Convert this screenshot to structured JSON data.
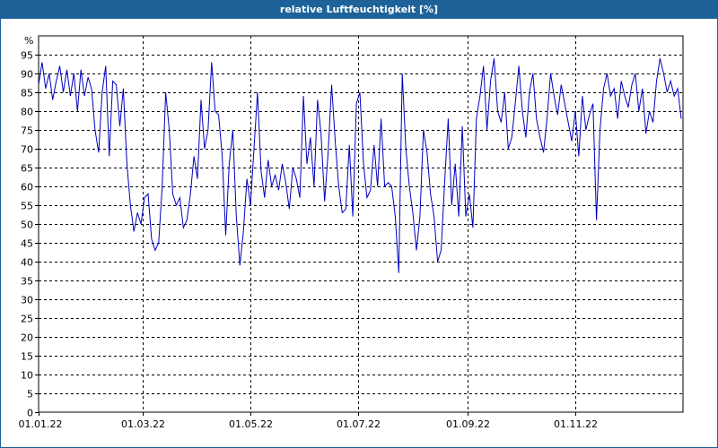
{
  "window": {
    "title": "relative Luftfeuchtigkeit [%]"
  },
  "chart_data": {
    "type": "line",
    "title": "relative Luftfeuchtigkeit [%]",
    "ylabel": "%",
    "xlabel": "",
    "ylim": [
      0,
      100
    ],
    "xlim": [
      "2022-01-01",
      "2022-12-31"
    ],
    "grid": true,
    "y_ticks": [
      0,
      5,
      10,
      15,
      20,
      25,
      30,
      35,
      40,
      45,
      50,
      55,
      60,
      65,
      70,
      75,
      80,
      85,
      90,
      95
    ],
    "x_ticks": [
      {
        "date": "2022-01-01",
        "label": "01.01.22"
      },
      {
        "date": "2022-03-01",
        "label": "01.03.22"
      },
      {
        "date": "2022-05-01",
        "label": "01.05.22"
      },
      {
        "date": "2022-07-01",
        "label": "01.07.22"
      },
      {
        "date": "2022-09-01",
        "label": "01.09.22"
      },
      {
        "date": "2022-11-01",
        "label": "01.11.22"
      }
    ],
    "colors": {
      "series": "#0000c0",
      "grid": "#000000",
      "title_bar": "#1d6399"
    },
    "series": [
      {
        "points": [
          [
            "2022-01-01",
            87
          ],
          [
            "2022-01-03",
            93
          ],
          [
            "2022-01-05",
            86
          ],
          [
            "2022-01-07",
            90
          ],
          [
            "2022-01-09",
            83
          ],
          [
            "2022-01-11",
            88
          ],
          [
            "2022-01-13",
            92
          ],
          [
            "2022-01-15",
            85
          ],
          [
            "2022-01-17",
            91
          ],
          [
            "2022-01-19",
            84
          ],
          [
            "2022-01-21",
            90
          ],
          [
            "2022-01-23",
            80
          ],
          [
            "2022-01-25",
            91
          ],
          [
            "2022-01-27",
            84
          ],
          [
            "2022-01-29",
            89
          ],
          [
            "2022-01-31",
            86
          ],
          [
            "2022-02-02",
            75
          ],
          [
            "2022-02-04",
            69
          ],
          [
            "2022-02-06",
            85
          ],
          [
            "2022-02-08",
            92
          ],
          [
            "2022-02-10",
            68
          ],
          [
            "2022-02-12",
            88
          ],
          [
            "2022-02-14",
            87
          ],
          [
            "2022-02-16",
            76
          ],
          [
            "2022-02-18",
            86
          ],
          [
            "2022-02-20",
            66
          ],
          [
            "2022-02-22",
            55
          ],
          [
            "2022-02-24",
            48
          ],
          [
            "2022-02-26",
            53
          ],
          [
            "2022-02-28",
            50
          ],
          [
            "2022-03-02",
            57
          ],
          [
            "2022-03-04",
            58
          ],
          [
            "2022-03-06",
            46
          ],
          [
            "2022-03-08",
            43
          ],
          [
            "2022-03-10",
            45
          ],
          [
            "2022-03-12",
            60
          ],
          [
            "2022-03-14",
            85
          ],
          [
            "2022-03-16",
            75
          ],
          [
            "2022-03-18",
            58
          ],
          [
            "2022-03-20",
            55
          ],
          [
            "2022-03-22",
            57
          ],
          [
            "2022-03-24",
            49
          ],
          [
            "2022-03-26",
            51
          ],
          [
            "2022-03-28",
            58
          ],
          [
            "2022-03-30",
            68
          ],
          [
            "2022-04-01",
            62
          ],
          [
            "2022-04-03",
            83
          ],
          [
            "2022-04-05",
            70
          ],
          [
            "2022-04-07",
            75
          ],
          [
            "2022-04-09",
            93
          ],
          [
            "2022-04-11",
            80
          ],
          [
            "2022-04-13",
            79
          ],
          [
            "2022-04-15",
            68
          ],
          [
            "2022-04-17",
            47
          ],
          [
            "2022-04-19",
            66
          ],
          [
            "2022-04-21",
            75
          ],
          [
            "2022-04-23",
            52
          ],
          [
            "2022-04-25",
            39
          ],
          [
            "2022-04-27",
            48
          ],
          [
            "2022-04-29",
            62
          ],
          [
            "2022-05-01",
            55
          ],
          [
            "2022-05-03",
            70
          ],
          [
            "2022-05-05",
            85
          ],
          [
            "2022-05-07",
            64
          ],
          [
            "2022-05-09",
            57
          ],
          [
            "2022-05-11",
            67
          ],
          [
            "2022-05-13",
            60
          ],
          [
            "2022-05-15",
            63
          ],
          [
            "2022-05-17",
            59
          ],
          [
            "2022-05-19",
            66
          ],
          [
            "2022-05-21",
            61
          ],
          [
            "2022-05-23",
            54
          ],
          [
            "2022-05-25",
            65
          ],
          [
            "2022-05-27",
            62
          ],
          [
            "2022-05-29",
            57
          ],
          [
            "2022-05-31",
            84
          ],
          [
            "2022-06-02",
            66
          ],
          [
            "2022-06-04",
            73
          ],
          [
            "2022-06-06",
            60
          ],
          [
            "2022-06-08",
            83
          ],
          [
            "2022-06-10",
            74
          ],
          [
            "2022-06-12",
            56
          ],
          [
            "2022-06-14",
            69
          ],
          [
            "2022-06-16",
            87
          ],
          [
            "2022-06-18",
            72
          ],
          [
            "2022-06-20",
            60
          ],
          [
            "2022-06-22",
            53
          ],
          [
            "2022-06-24",
            54
          ],
          [
            "2022-06-26",
            71
          ],
          [
            "2022-06-28",
            52
          ],
          [
            "2022-06-30",
            82
          ],
          [
            "2022-07-02",
            85
          ],
          [
            "2022-07-04",
            66
          ],
          [
            "2022-07-06",
            57
          ],
          [
            "2022-07-08",
            59
          ],
          [
            "2022-07-10",
            71
          ],
          [
            "2022-07-12",
            60
          ],
          [
            "2022-07-14",
            78
          ],
          [
            "2022-07-16",
            60
          ],
          [
            "2022-07-18",
            61
          ],
          [
            "2022-07-20",
            60
          ],
          [
            "2022-07-22",
            52
          ],
          [
            "2022-07-24",
            37
          ],
          [
            "2022-07-26",
            90
          ],
          [
            "2022-07-28",
            70
          ],
          [
            "2022-07-30",
            60
          ],
          [
            "2022-08-01",
            53
          ],
          [
            "2022-08-03",
            43
          ],
          [
            "2022-08-05",
            52
          ],
          [
            "2022-08-07",
            75
          ],
          [
            "2022-08-09",
            69
          ],
          [
            "2022-08-11",
            58
          ],
          [
            "2022-08-13",
            52
          ],
          [
            "2022-08-15",
            40
          ],
          [
            "2022-08-17",
            43
          ],
          [
            "2022-08-19",
            61
          ],
          [
            "2022-08-21",
            78
          ],
          [
            "2022-08-23",
            55
          ],
          [
            "2022-08-25",
            66
          ],
          [
            "2022-08-27",
            52
          ],
          [
            "2022-08-29",
            76
          ],
          [
            "2022-08-31",
            52
          ],
          [
            "2022-09-02",
            58
          ],
          [
            "2022-09-04",
            49
          ],
          [
            "2022-09-06",
            78
          ],
          [
            "2022-09-08",
            84
          ],
          [
            "2022-09-10",
            92
          ],
          [
            "2022-09-12",
            75
          ],
          [
            "2022-09-14",
            88
          ],
          [
            "2022-09-16",
            94
          ],
          [
            "2022-09-18",
            80
          ],
          [
            "2022-09-20",
            77
          ],
          [
            "2022-09-22",
            85
          ],
          [
            "2022-09-24",
            70
          ],
          [
            "2022-09-26",
            73
          ],
          [
            "2022-09-28",
            82
          ],
          [
            "2022-09-30",
            92
          ],
          [
            "2022-10-02",
            80
          ],
          [
            "2022-10-04",
            73
          ],
          [
            "2022-10-06",
            85
          ],
          [
            "2022-10-08",
            90
          ],
          [
            "2022-10-10",
            78
          ],
          [
            "2022-10-12",
            73
          ],
          [
            "2022-10-14",
            69
          ],
          [
            "2022-10-16",
            78
          ],
          [
            "2022-10-18",
            90
          ],
          [
            "2022-10-20",
            84
          ],
          [
            "2022-10-22",
            79
          ],
          [
            "2022-10-24",
            87
          ],
          [
            "2022-10-26",
            82
          ],
          [
            "2022-10-28",
            77
          ],
          [
            "2022-10-30",
            72
          ],
          [
            "2022-11-01",
            80
          ],
          [
            "2022-11-03",
            68
          ],
          [
            "2022-11-05",
            84
          ],
          [
            "2022-11-07",
            75
          ],
          [
            "2022-11-09",
            79
          ],
          [
            "2022-11-11",
            82
          ],
          [
            "2022-11-13",
            51
          ],
          [
            "2022-11-15",
            75
          ],
          [
            "2022-11-17",
            86
          ],
          [
            "2022-11-19",
            90
          ],
          [
            "2022-11-21",
            84
          ],
          [
            "2022-11-23",
            86
          ],
          [
            "2022-11-25",
            78
          ],
          [
            "2022-11-27",
            88
          ],
          [
            "2022-11-29",
            84
          ],
          [
            "2022-12-01",
            81
          ],
          [
            "2022-12-03",
            87
          ],
          [
            "2022-12-05",
            90
          ],
          [
            "2022-12-07",
            80
          ],
          [
            "2022-12-09",
            86
          ],
          [
            "2022-12-11",
            74
          ],
          [
            "2022-12-13",
            80
          ],
          [
            "2022-12-15",
            77
          ],
          [
            "2022-12-17",
            88
          ],
          [
            "2022-12-19",
            94
          ],
          [
            "2022-12-21",
            90
          ],
          [
            "2022-12-23",
            85
          ],
          [
            "2022-12-25",
            88
          ],
          [
            "2022-12-27",
            84
          ],
          [
            "2022-12-29",
            86
          ],
          [
            "2022-12-31",
            78
          ]
        ]
      }
    ]
  }
}
